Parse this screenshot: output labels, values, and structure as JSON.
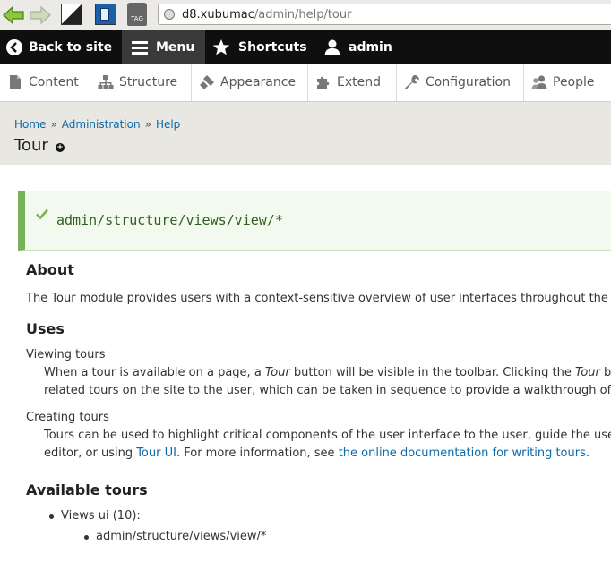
{
  "browser": {
    "url_host": "d8.xubumac",
    "url_path": "/admin/help/tour",
    "tag_label": "TAG"
  },
  "toolbar": {
    "back_label": "Back to site",
    "menu_label": "Menu",
    "shortcuts_label": "Shortcuts",
    "user_label": "admin"
  },
  "tray": {
    "items": [
      {
        "label": "Content"
      },
      {
        "label": "Structure"
      },
      {
        "label": "Appearance"
      },
      {
        "label": "Extend"
      },
      {
        "label": "Configuration"
      },
      {
        "label": "People"
      }
    ]
  },
  "breadcrumb": {
    "items": [
      {
        "label": "Home"
      },
      {
        "label": "Administration"
      },
      {
        "label": "Help"
      }
    ],
    "separator": "»"
  },
  "page": {
    "title": "Tour"
  },
  "status": {
    "message": "admin/structure/views/view/*"
  },
  "content": {
    "about_heading": "About",
    "about_text": "The Tour module provides users with a context-sensitive overview of user interfaces throughout the",
    "uses_heading": "Uses",
    "viewing_title": "Viewing tours",
    "viewing_text_1a": "When a tour is available on a page, a ",
    "viewing_text_1b": "Tour",
    "viewing_text_1c": " button will be visible in the toolbar. Clicking the ",
    "viewing_text_1d": "Tour",
    "viewing_text_1e": " bu",
    "viewing_text_2": "related tours on the site to the user, which can be taken in sequence to provide a walkthrough of",
    "creating_title": "Creating tours",
    "creating_text_1": "Tours can be used to highlight critical components of the user interface to the user, guide the use",
    "creating_text_2a": "editor, or using ",
    "creating_text_2_link1": "Tour UI",
    "creating_text_2b": ". For more information, see ",
    "creating_text_2_link2": "the online documentation for writing tours",
    "creating_text_2c": ".",
    "available_heading": "Available tours",
    "tour_group_label": "Views ui (10):",
    "tour_item": "admin/structure/views/view/*"
  },
  "colors": {
    "toolbar_bg": "#0f0f0f",
    "link": "#0b6aab",
    "status_border": "#77b259",
    "status_text": "#325e1c"
  }
}
